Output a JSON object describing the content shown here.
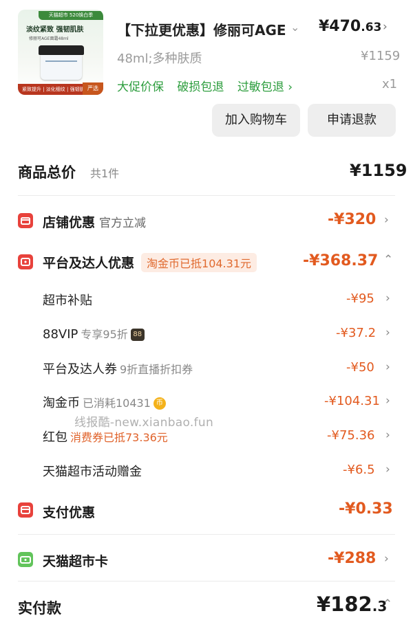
{
  "product": {
    "thumb_tag": "天猫超市 520焕白季",
    "thumb_headline": "淡纹紧致 强韧肌肤",
    "thumb_sub": "修丽可AGE面霜48ml",
    "thumb_bottom": "紧致提升 | 淡化细纹 | 强韧肌肤",
    "thumb_badge": "严选",
    "title": "【下拉更优惠】修丽可AGE",
    "price_int": "¥470",
    "price_dec": ".63",
    "spec": "48ml;多种肤质",
    "original_price": "¥1159",
    "services": [
      "大促价保",
      "破损包退",
      "过敏包退 ›"
    ],
    "quantity": "x1",
    "add_to_cart": "加入购物车",
    "request_refund": "申请退款"
  },
  "summary": {
    "total_label": "商品总价",
    "total_count": "共1件",
    "total_amount": "¥1159",
    "store_discount": {
      "label": "店铺优惠",
      "note": "官方立减",
      "amount": "-¥320"
    },
    "platform_discount": {
      "label": "平台及达人优惠",
      "pill": "淘金币已抵104.31元",
      "amount": "-¥368.37"
    },
    "details": [
      {
        "label": "超市补贴",
        "extra": "",
        "amount": "-¥95"
      },
      {
        "label": "88VIP",
        "extra": "专享95折",
        "badge": "88",
        "amount": "-¥37.2"
      },
      {
        "label": "平台及达人券",
        "extra": "9折直播折扣券",
        "amount": "-¥50"
      },
      {
        "label": "淘金币",
        "extra": "已消耗10431",
        "coin": "币",
        "amount": "-¥104.31"
      },
      {
        "label": "红包",
        "extra": "消费券已抵73.36元",
        "amount": "-¥75.36"
      },
      {
        "label": "天猫超市活动赠金",
        "extra": "",
        "amount": "-¥6.5"
      }
    ],
    "payment_discount": {
      "label": "支付优惠",
      "amount": "-¥0.33"
    },
    "tmall_card": {
      "label": "天猫超市卡",
      "amount": "-¥288"
    },
    "paid_label": "实付款",
    "paid_int": "¥182",
    "paid_dec": ".3"
  },
  "watermark": "线报酷-new.xianbao.fun",
  "colors": {
    "discount": "#e25a1f",
    "service": "#2c9d3d",
    "icon_red": "#e8423c",
    "icon_green": "#62c45b"
  }
}
